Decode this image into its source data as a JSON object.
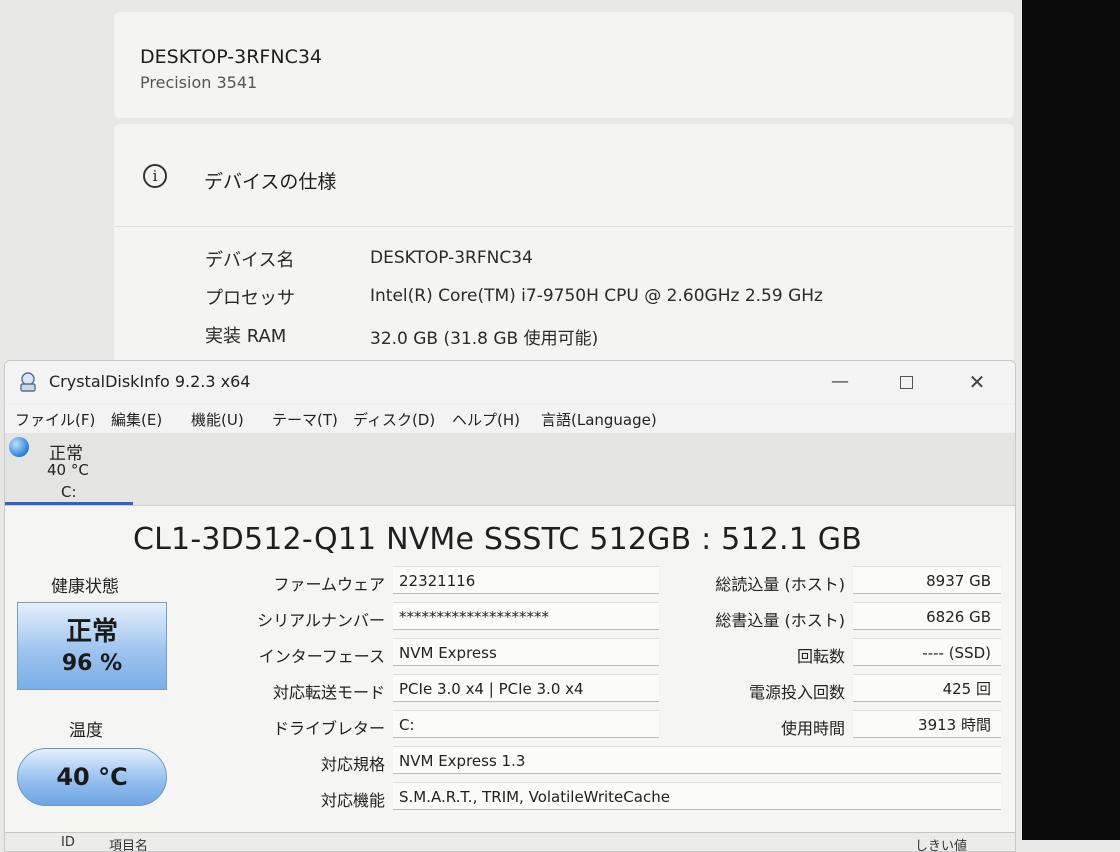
{
  "settings": {
    "device_name": "DESKTOP-3RFNC34",
    "device_model": "Precision 3541",
    "spec_title": "デバイスの仕様",
    "rows": [
      {
        "label": "デバイス名",
        "value": "DESKTOP-3RFNC34"
      },
      {
        "label": "プロセッサ",
        "value": "Intel(R) Core(TM) i7-9750H CPU @ 2.60GHz   2.59 GHz"
      },
      {
        "label": "実装 RAM",
        "value": "32.0 GB (31.8 GB 使用可能)"
      }
    ]
  },
  "window": {
    "title": "CrystalDiskInfo 9.2.3 x64",
    "close_glyph": "✕",
    "min_glyph": "—"
  },
  "menu": [
    "ファイル(F)",
    "編集(E)",
    "機能(U)",
    "テーマ(T)",
    "ディスク(D)",
    "ヘルプ(H)",
    "言語(Language)"
  ],
  "drive_tab": {
    "status": "正常",
    "temp": "40 °C",
    "letter": "C:"
  },
  "disk": {
    "model": "CL1-3D512-Q11 NVMe SSSTC 512GB : 512.1 GB",
    "health_label": "健康状態",
    "health_status": "正常",
    "health_percent": "96 %",
    "temp_label": "温度",
    "temp_value": "40 °C",
    "left_attrs": [
      {
        "label": "ファームウェア",
        "value": "22321116"
      },
      {
        "label": "シリアルナンバー",
        "value": "********************"
      },
      {
        "label": "インターフェース",
        "value": "NVM Express"
      },
      {
        "label": "対応転送モード",
        "value": "PCIe 3.0 x4 | PCIe 3.0 x4"
      },
      {
        "label": "ドライブレター",
        "value": "C:"
      }
    ],
    "right_attrs": [
      {
        "label": "総読込量 (ホスト)",
        "value": "8937 GB"
      },
      {
        "label": "総書込量 (ホスト)",
        "value": "6826 GB"
      },
      {
        "label": "回転数",
        "value": "---- (SSD)"
      },
      {
        "label": "電源投入回数",
        "value": "425 回"
      },
      {
        "label": "使用時間",
        "value": "3913 時間"
      }
    ],
    "wide_attrs": [
      {
        "label": "対応規格",
        "value": "NVM Express 1.3"
      },
      {
        "label": "対応機能",
        "value": "S.M.A.R.T., TRIM, VolatileWriteCache"
      }
    ],
    "table_headers": {
      "id": "ID",
      "name": "項目名",
      "threshold": "しきい値"
    }
  },
  "colors": {
    "accent": "#2c63c8",
    "health_blue": "#7aaee8"
  }
}
